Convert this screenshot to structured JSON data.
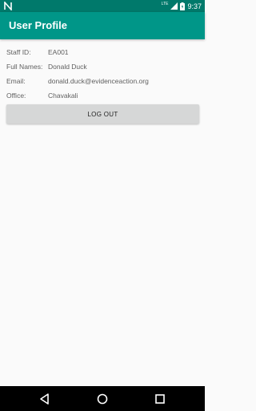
{
  "status_bar": {
    "time": "9:37",
    "network_label": "LTE",
    "icons": [
      "notification-n-icon",
      "signal-icon",
      "battery-icon"
    ]
  },
  "app_bar": {
    "title": "User Profile",
    "color": "#009688",
    "status_color": "#00796b"
  },
  "profile": {
    "fields": [
      {
        "label": "Staff ID:",
        "value": "EA001"
      },
      {
        "label": "Full Names:",
        "value": "Donald Duck"
      },
      {
        "label": "Email:",
        "value": "donald.duck@evidenceaction.org"
      },
      {
        "label": "Office:",
        "value": "Chavakali"
      }
    ]
  },
  "actions": {
    "logout_label": "LOG OUT"
  },
  "nav_bar": {
    "icons": [
      "back-icon",
      "home-icon",
      "recents-icon"
    ]
  }
}
